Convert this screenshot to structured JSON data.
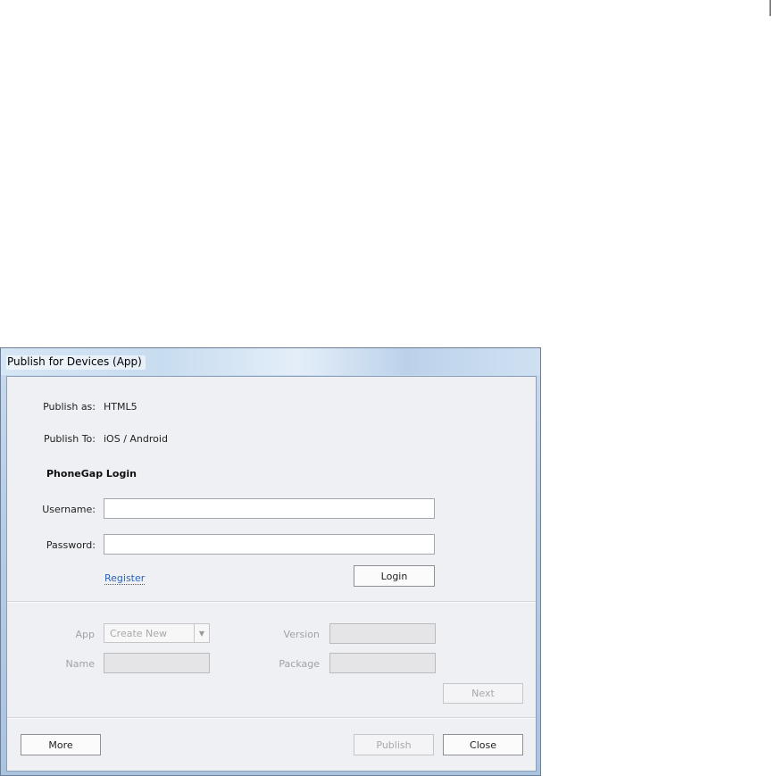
{
  "dialog": {
    "title": "Publish for Devices (App)"
  },
  "info": {
    "publish_as_label": "Publish as:",
    "publish_as_value": "HTML5",
    "publish_to_label": "Publish To:",
    "publish_to_value": "iOS / Android"
  },
  "login": {
    "heading": "PhoneGap Login",
    "username_label": "Username:",
    "username_value": "",
    "password_label": "Password:",
    "password_value": "",
    "register_link": "Register",
    "login_button": "Login"
  },
  "app_section": {
    "app_label": "App",
    "app_selected": "Create New",
    "version_label": "Version",
    "name_label": "Name",
    "package_label": "Package",
    "next_button": "Next"
  },
  "footer": {
    "more_button": "More",
    "publish_button": "Publish",
    "close_button": "Close"
  },
  "icons": {
    "dropdown": "chevron-down-icon"
  }
}
